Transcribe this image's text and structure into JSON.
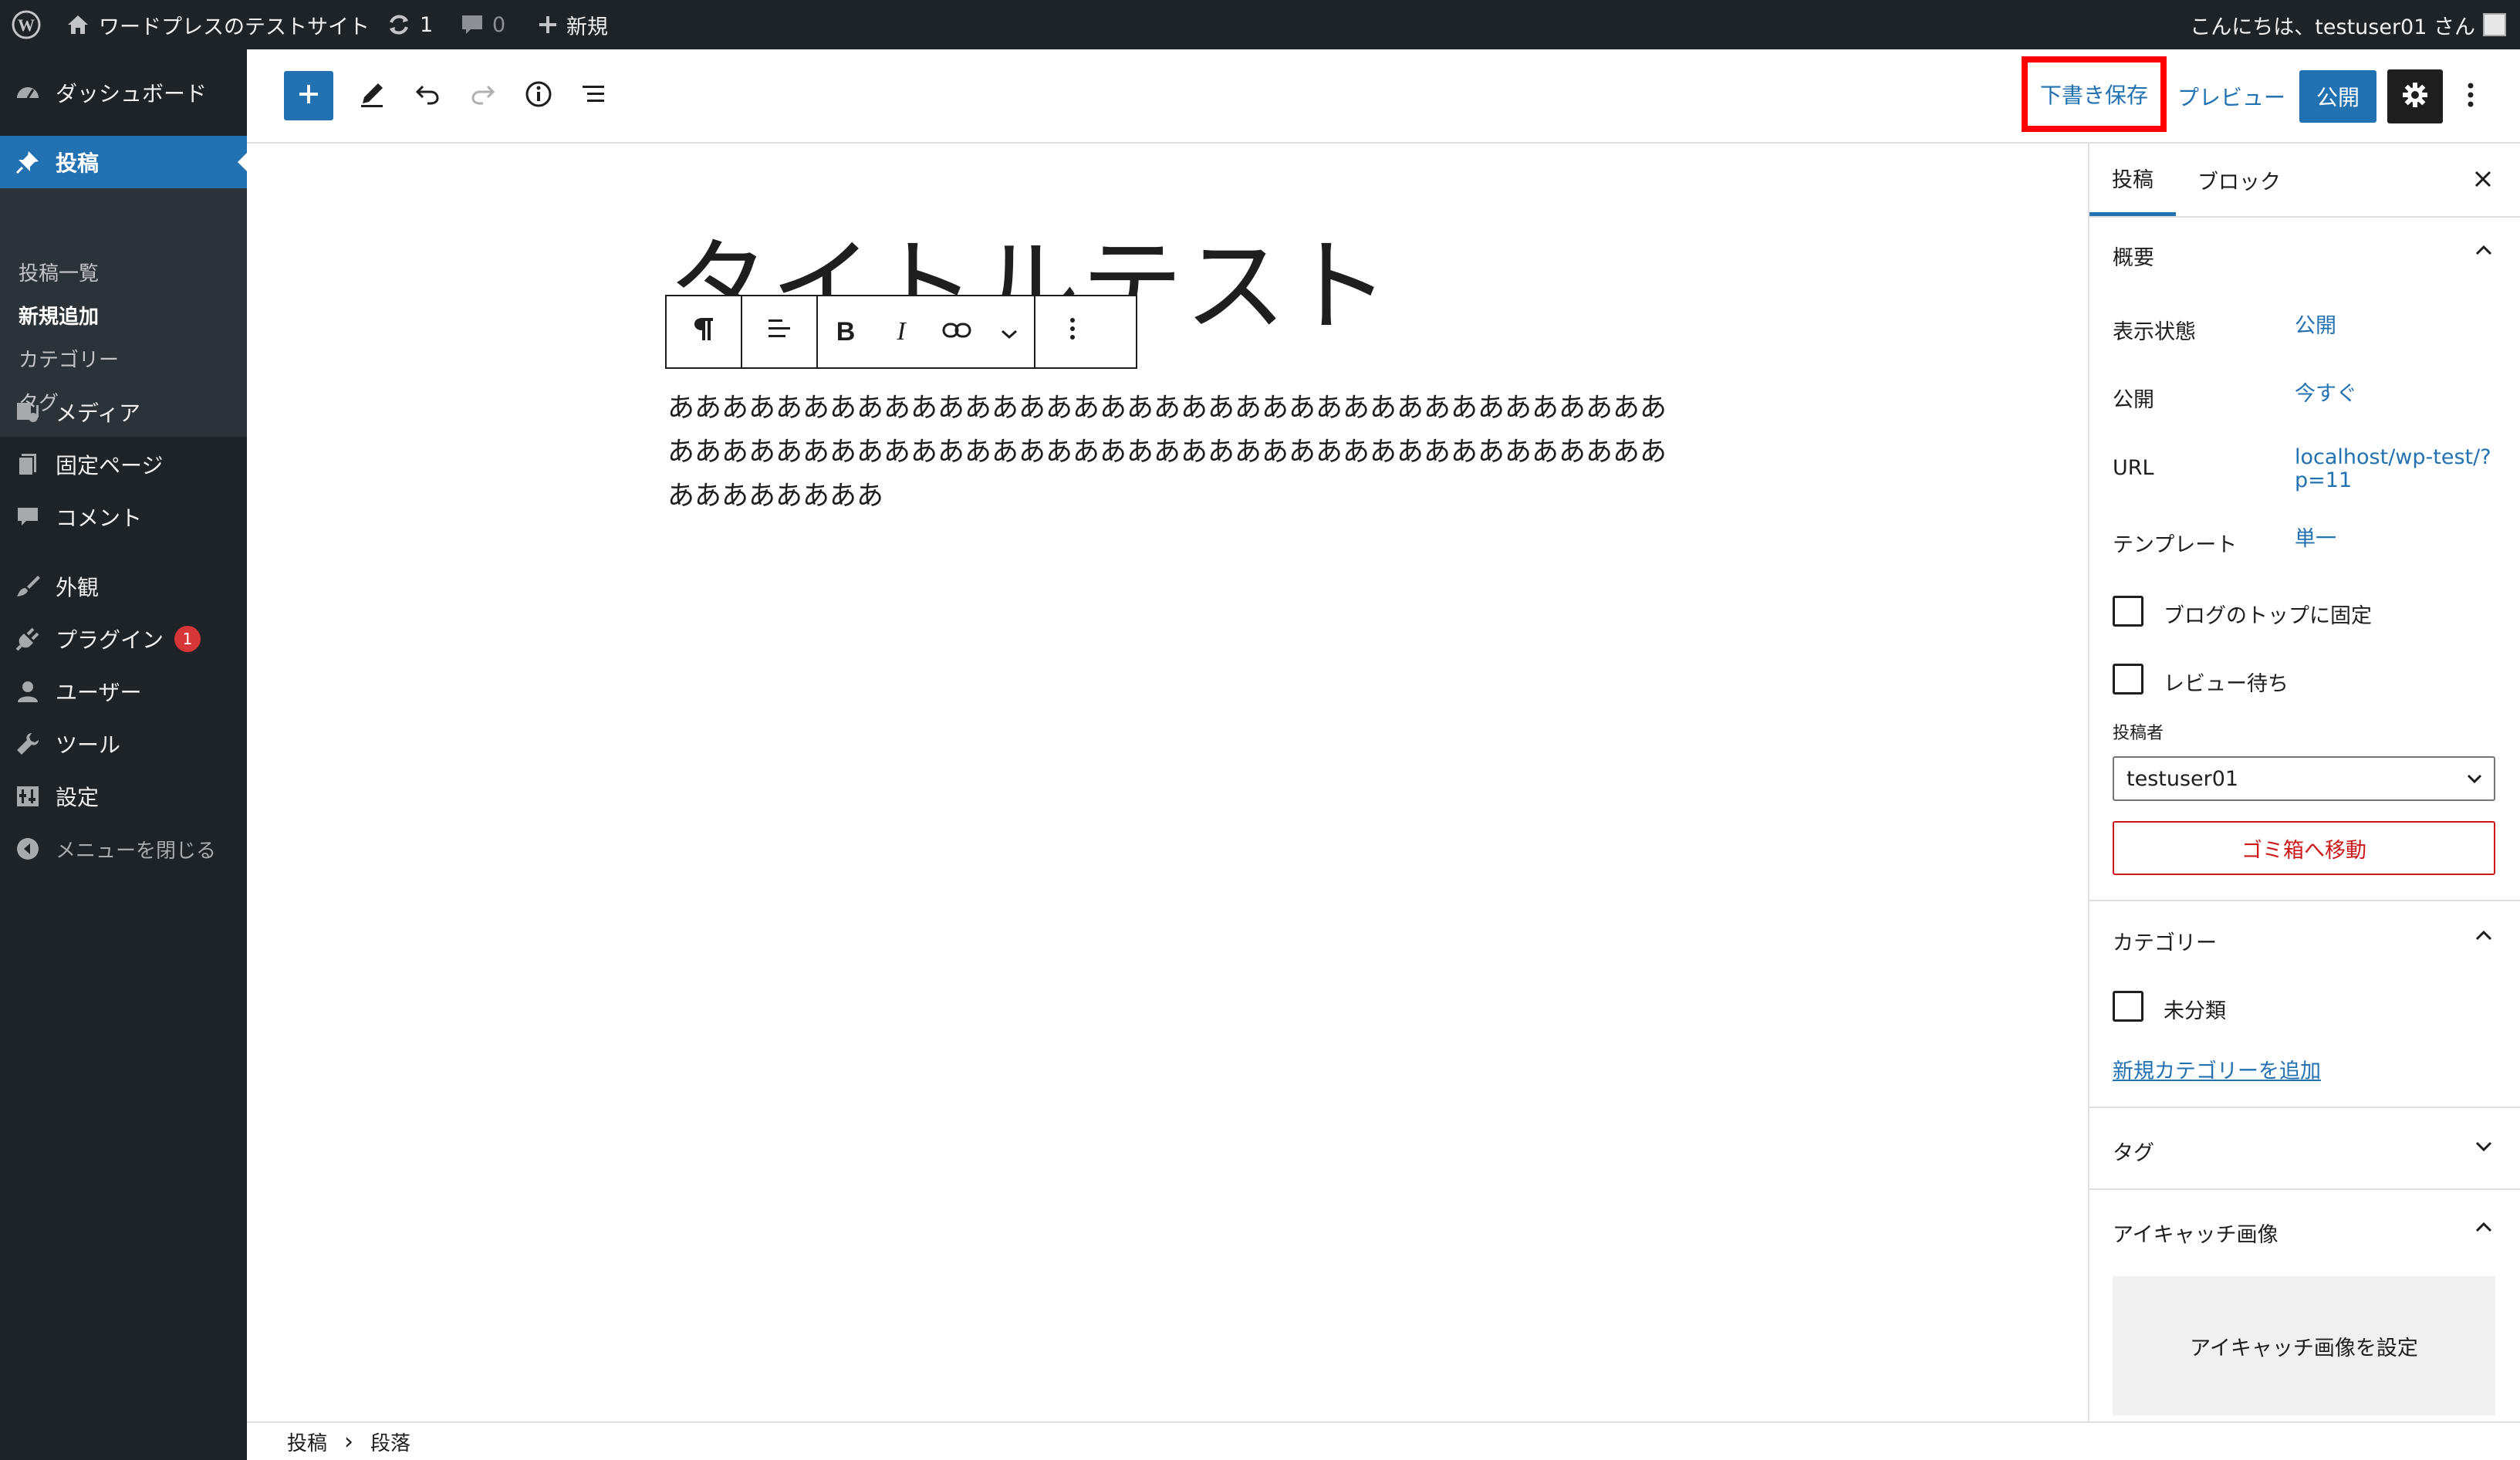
{
  "adminbar": {
    "site_name": "ワードプレスのテストサイト",
    "updates_count": "1",
    "comments_count": "0",
    "new_label": "新規",
    "greeting": "こんにちは、testuser01 さん"
  },
  "sidebar": {
    "dashboard": "ダッシュボード",
    "posts": "投稿",
    "posts_sub": [
      "投稿一覧",
      "新規追加",
      "カテゴリー",
      "タグ"
    ],
    "media": "メディア",
    "pages": "固定ページ",
    "comments": "コメント",
    "appearance": "外観",
    "plugins": "プラグイン",
    "plugins_badge": "1",
    "users": "ユーザー",
    "tools": "ツール",
    "settings": "設定",
    "collapse": "メニューを閉じる"
  },
  "header": {
    "save_draft": "下書き保存",
    "preview": "プレビュー",
    "publish": "公開",
    "highlight_color": "#ff0000",
    "accent_color": "#2271b1"
  },
  "editor": {
    "title": "タイトルテスト",
    "paragraph": "ああああああああああああああああああああああああああああああああああああああああああああああああああああああああああああああああああああああああああああああああああ",
    "toolbar": [
      "paragraph-icon",
      "align-icon",
      "bold-icon",
      "italic-icon",
      "link-icon",
      "chevron-down-icon",
      "more-vertical-icon"
    ],
    "toolbar_bold": "B",
    "toolbar_italic": "I"
  },
  "breadcrumb": {
    "root": "投稿",
    "separator": "›",
    "current": "段落"
  },
  "settings": {
    "tabs": [
      "投稿",
      "ブロック"
    ],
    "summary_title": "概要",
    "visibility_label": "表示状態",
    "visibility_value": "公開",
    "publish_label": "公開",
    "publish_value": "今すぐ",
    "url_label": "URL",
    "url_value": "localhost/wp-test/?p=11",
    "template_label": "テンプレート",
    "template_value": "単一",
    "sticky_label": "ブログのトップに固定",
    "pending_label": "レビュー待ち",
    "author_label": "投稿者",
    "author_value": "testuser01",
    "trash_label": "ゴミ箱へ移動",
    "categories_title": "カテゴリー",
    "category_uncategorized": "未分類",
    "add_category": "新規カテゴリーを追加",
    "tags_title": "タグ",
    "featured_title": "アイキャッチ画像",
    "featured_button": "アイキャッチ画像を設定"
  }
}
